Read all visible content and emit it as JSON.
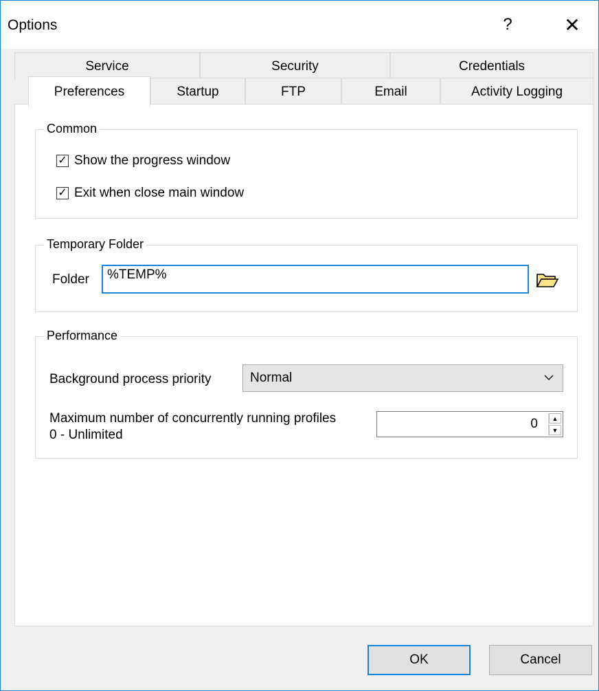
{
  "window": {
    "title": "Options",
    "help_glyph": "?",
    "close_glyph": "✕"
  },
  "tabs": {
    "row_back": [
      {
        "label": "Service"
      },
      {
        "label": "Security"
      },
      {
        "label": "Credentials"
      }
    ],
    "row_front": [
      {
        "label": "Preferences",
        "active": true
      },
      {
        "label": "Startup"
      },
      {
        "label": "FTP"
      },
      {
        "label": "Email"
      },
      {
        "label": "Activity Logging"
      }
    ]
  },
  "common": {
    "title": "Common",
    "show_progress": {
      "label": "Show the progress window",
      "checked": true
    },
    "exit_on_close": {
      "label": "Exit when close main window",
      "checked": true
    }
  },
  "temp_folder": {
    "title": "Temporary Folder",
    "folder_label": "Folder",
    "folder_value": "%TEMP%",
    "browse_icon": "folder-open-icon"
  },
  "performance": {
    "title": "Performance",
    "priority_label": "Background process priority",
    "priority_value": "Normal",
    "max_label_line1": "Maximum number of concurrently running profiles",
    "max_label_line2": "0 - Unlimited",
    "max_value": "0"
  },
  "buttons": {
    "ok": "OK",
    "cancel": "Cancel"
  },
  "colors": {
    "accent": "#1883d7",
    "window_bg": "#f0f0f0",
    "panel_bg": "#ffffff"
  }
}
